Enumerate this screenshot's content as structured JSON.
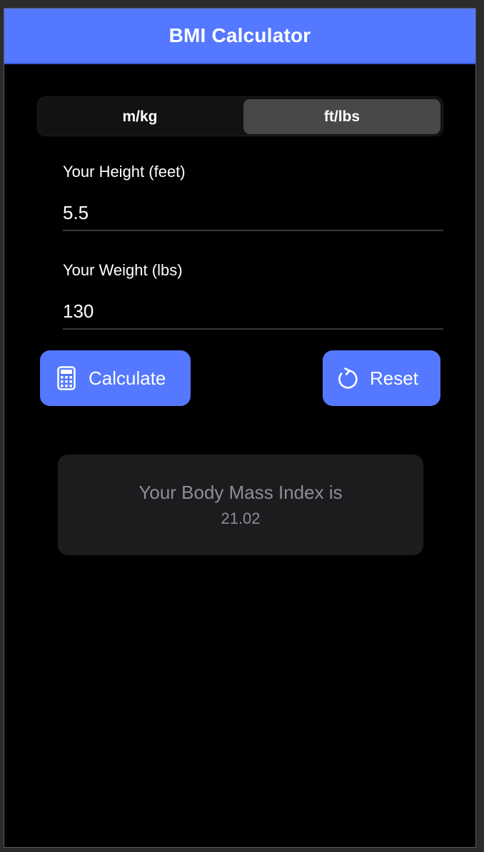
{
  "header": {
    "title": "BMI Calculator"
  },
  "unit_toggle": {
    "options": [
      "m/kg",
      "ft/lbs"
    ],
    "selected": "ft/lbs"
  },
  "height": {
    "label": "Your Height (feet)",
    "value": "5.5"
  },
  "weight": {
    "label": "Your Weight (lbs)",
    "value": "130"
  },
  "actions": {
    "calculate_label": "Calculate",
    "calculate_icon": "calculator-icon",
    "reset_label": "Reset",
    "reset_icon": "refresh-icon"
  },
  "result": {
    "label": "Your Body Mass Index is",
    "value": "21.02"
  },
  "colors": {
    "accent": "#5478ff",
    "background": "#000000",
    "card": "#1c1c1e",
    "muted_text": "#8e8e93"
  }
}
